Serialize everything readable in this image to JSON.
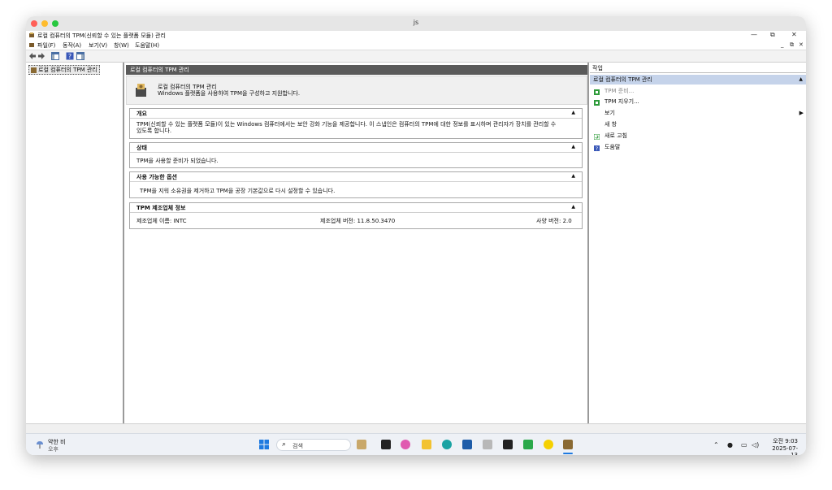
{
  "window": {
    "title": "js"
  },
  "app": {
    "title": "로컬 컴퓨터의 TPM(신뢰할 수 있는 플랫폼 모듈) 관리",
    "controls": {
      "minimize": "—",
      "restore": "⧉",
      "close": "✕"
    },
    "inner_controls": {
      "minimize": "_",
      "restore": "⧉",
      "close": "✕"
    }
  },
  "menu": [
    "파일(F)",
    "동작(A)",
    "보기(V)",
    "창(W)",
    "도움말(H)"
  ],
  "tree": {
    "node_label": "로컬 컴퓨터의 TPM 관리"
  },
  "center": {
    "header": "로컬 컴퓨터의 TPM 관리",
    "intro_title": "로컬 컴퓨터의 TPM 관리",
    "intro_desc": "Windows 플랫폼을 사용하여 TPM을 구성하고 지원합니다.",
    "sections": [
      {
        "title": "개요",
        "body": [
          "TPM(신뢰할 수 있는 플랫폼 모듈)이 있는 Windows 컴퓨터에서는 보안 강화 기능을 제공합니다. 이 스냅인은 컴퓨터의 TPM에 대한 정보를 표시하며 관리자가 장치를 관리할 수",
          "있도록 합니다."
        ]
      },
      {
        "title": "상태",
        "body": [
          "TPM을 사용할 준비가 되었습니다."
        ]
      },
      {
        "title": "사용 가능한 옵션",
        "body": [
          "TPM을 지워 소유권을 제거하고 TPM을 공장 기본값으로 다시 설정할 수 있습니다."
        ]
      },
      {
        "title": "TPM 제조업체 정보",
        "manufacturer": "제조업체 이름: INTC",
        "mfr_version": "제조업체 버전: 11.8.50.3470",
        "spec_version": "사양 버전: 2.0"
      }
    ]
  },
  "actions": {
    "header": "작업",
    "subheader": "로컬 컴퓨터의 TPM 관리",
    "items": [
      {
        "label": "TPM 준비...",
        "icon": "tpm-prepare-icon",
        "disabled": true
      },
      {
        "label": "TPM 지우기...",
        "icon": "tpm-clear-icon",
        "disabled": false
      },
      {
        "label": "보기",
        "icon": "",
        "disabled": false,
        "submenu": true
      },
      {
        "label": "새 창",
        "icon": "",
        "disabled": false
      },
      {
        "label": "새로 고침",
        "icon": "refresh-icon",
        "disabled": false
      },
      {
        "label": "도움말",
        "icon": "help-icon",
        "disabled": false
      }
    ]
  },
  "taskbar": {
    "weather_title": "약한 비",
    "weather_sub": "오후",
    "search_placeholder": "검색",
    "time": "오전 9:03",
    "date": "2025-07-13"
  },
  "colors": {
    "accent": "#c5d3ea",
    "header_dark": "#5a5a5a",
    "green_icon": "#2e9b3a",
    "help_blue": "#3a58b8"
  }
}
